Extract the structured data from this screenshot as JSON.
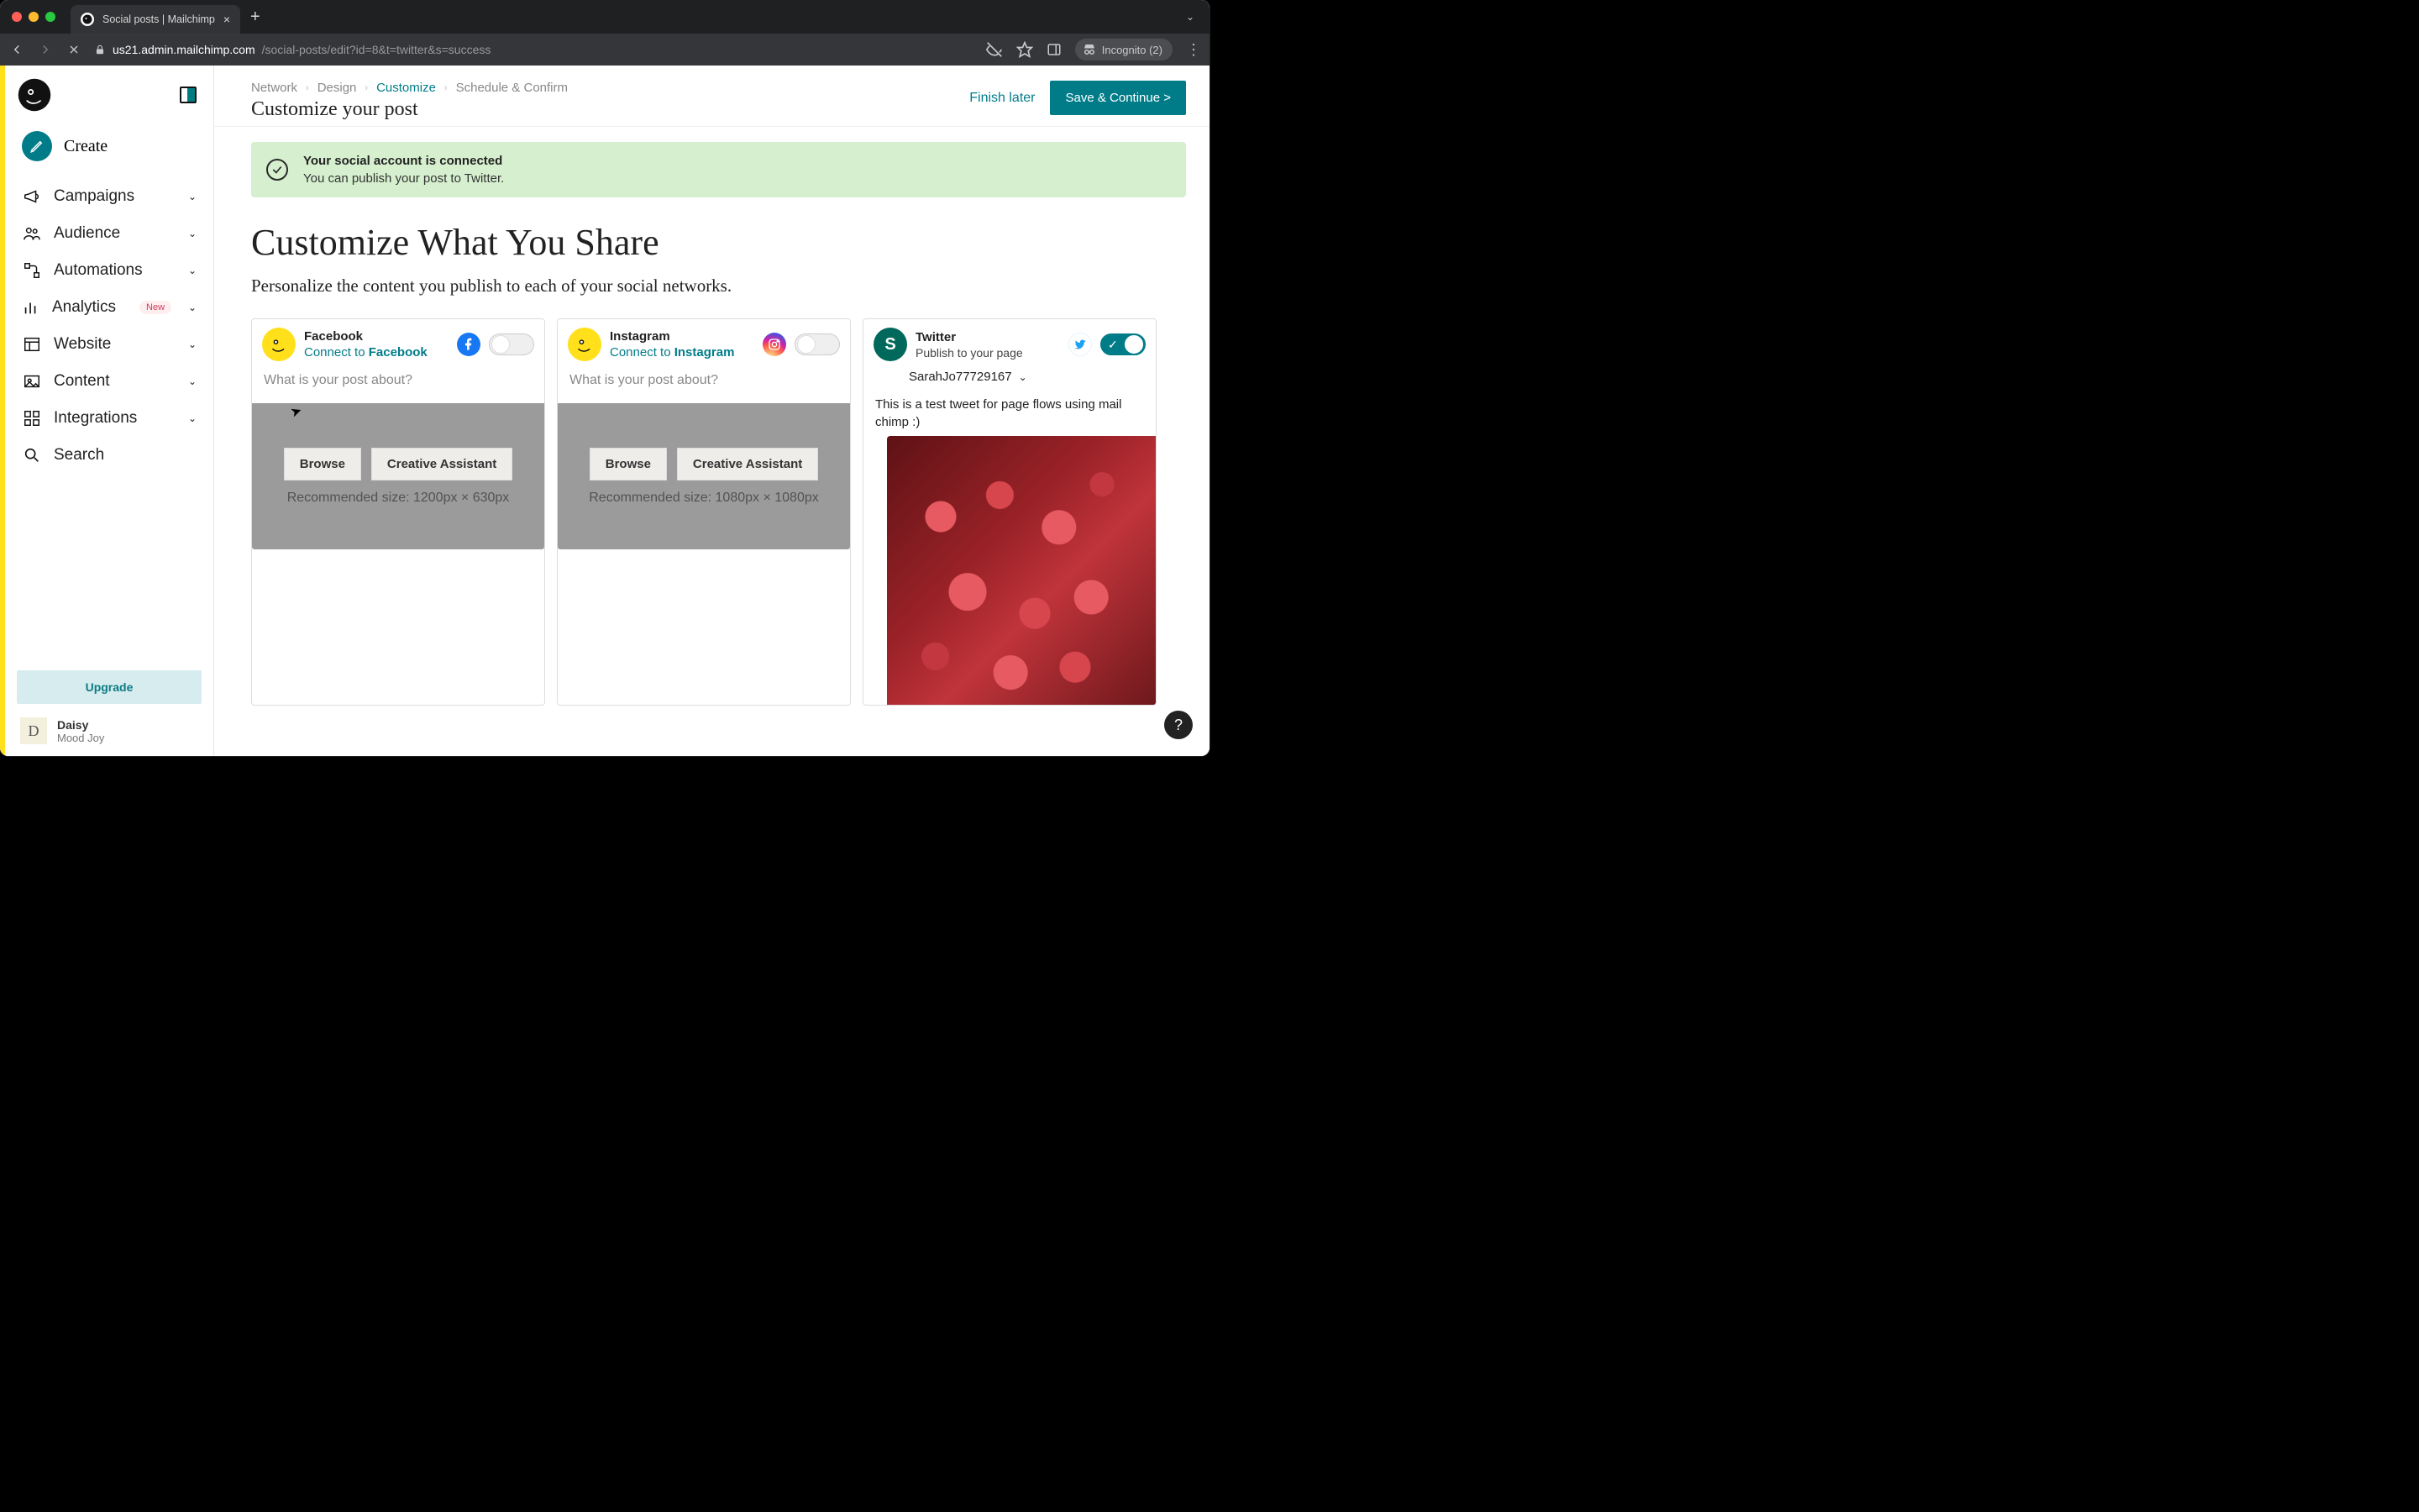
{
  "browser": {
    "tab_title": "Social posts | Mailchimp",
    "url_host": "us21.admin.mailchimp.com",
    "url_path": "/social-posts/edit?id=8&t=twitter&s=success",
    "incognito_label": "Incognito (2)"
  },
  "sidebar": {
    "create": "Create",
    "items": [
      {
        "label": "Campaigns",
        "expandable": true
      },
      {
        "label": "Audience",
        "expandable": true
      },
      {
        "label": "Automations",
        "expandable": true
      },
      {
        "label": "Analytics",
        "expandable": true,
        "badge": "New"
      },
      {
        "label": "Website",
        "expandable": true
      },
      {
        "label": "Content",
        "expandable": true
      },
      {
        "label": "Integrations",
        "expandable": true
      },
      {
        "label": "Search",
        "expandable": false
      }
    ],
    "upgrade": "Upgrade",
    "profile": {
      "initial": "D",
      "name": "Daisy",
      "sub": "Mood Joy"
    }
  },
  "breadcrumbs": [
    "Network",
    "Design",
    "Customize",
    "Schedule & Confirm"
  ],
  "breadcrumbs_active_index": 2,
  "page_subtitle": "Customize your post",
  "actions": {
    "finish": "Finish later",
    "save": "Save & Continue >"
  },
  "banner": {
    "title": "Your social account is connected",
    "message": "You can publish your post to Twitter."
  },
  "heading": "Customize What You Share",
  "lede": "Personalize the content you publish to each of your social networks.",
  "cards": {
    "facebook": {
      "title": "Facebook",
      "connect_prefix": "Connect to ",
      "connect_brand": "Facebook",
      "placeholder": "What is your post about?",
      "browse": "Browse",
      "creative": "Creative Assistant",
      "recommended": "Recommended size: 1200px × 630px",
      "enabled": false
    },
    "instagram": {
      "title": "Instagram",
      "connect_prefix": "Connect to ",
      "connect_brand": "Instagram",
      "placeholder": "What is your post about?",
      "browse": "Browse",
      "creative": "Creative Assistant",
      "recommended": "Recommended size: 1080px × 1080px",
      "enabled": false
    },
    "twitter": {
      "title": "Twitter",
      "subtitle": "Publish to your page",
      "handle": "SarahJo77729167",
      "tweet": "This is a test tweet for page flows using mail chimp :)",
      "enabled": true,
      "avatar_initial": "S"
    }
  }
}
